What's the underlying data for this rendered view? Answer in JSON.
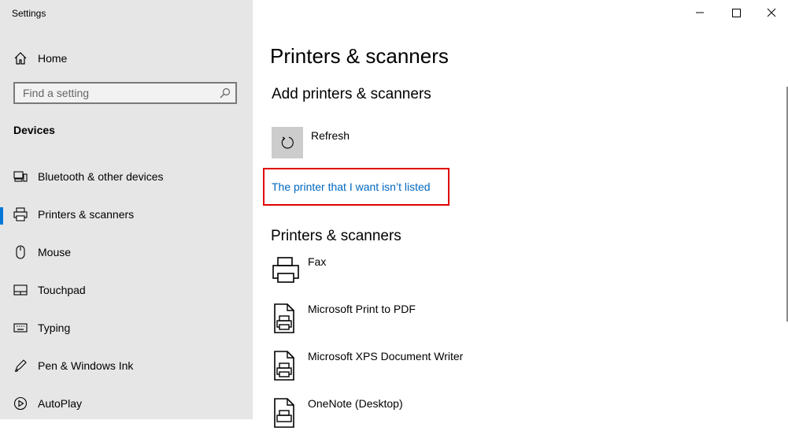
{
  "window": {
    "title": "Settings",
    "buttons": [
      "minimize",
      "maximize",
      "close"
    ]
  },
  "sidebar": {
    "home_label": "Home",
    "search_placeholder": "Find a setting",
    "section": "Devices",
    "items": [
      {
        "label": "Bluetooth & other devices",
        "icon": "bluetooth-devices-icon",
        "active": false
      },
      {
        "label": "Printers & scanners",
        "icon": "printer-icon",
        "active": true
      },
      {
        "label": "Mouse",
        "icon": "mouse-icon",
        "active": false
      },
      {
        "label": "Touchpad",
        "icon": "touchpad-icon",
        "active": false
      },
      {
        "label": "Typing",
        "icon": "keyboard-icon",
        "active": false
      },
      {
        "label": "Pen & Windows Ink",
        "icon": "pen-icon",
        "active": false
      },
      {
        "label": "AutoPlay",
        "icon": "autoplay-icon",
        "active": false
      }
    ]
  },
  "main": {
    "title": "Printers & scanners",
    "add_heading": "Add printers & scanners",
    "refresh_label": "Refresh",
    "not_listed_link": "The printer that I want isn’t listed",
    "list_heading": "Printers & scanners",
    "printers": [
      {
        "name": "Fax",
        "icon": "fax-printer-icon"
      },
      {
        "name": "Microsoft Print to PDF",
        "icon": "document-printer-icon"
      },
      {
        "name": "Microsoft XPS Document Writer",
        "icon": "document-printer-icon"
      },
      {
        "name": "OneNote (Desktop)",
        "icon": "document-printer-icon"
      }
    ]
  },
  "colors": {
    "accent": "#0078d7",
    "link": "#0067c0",
    "highlight_border": "#e00000",
    "sidebar_bg": "#e6e6e6"
  }
}
